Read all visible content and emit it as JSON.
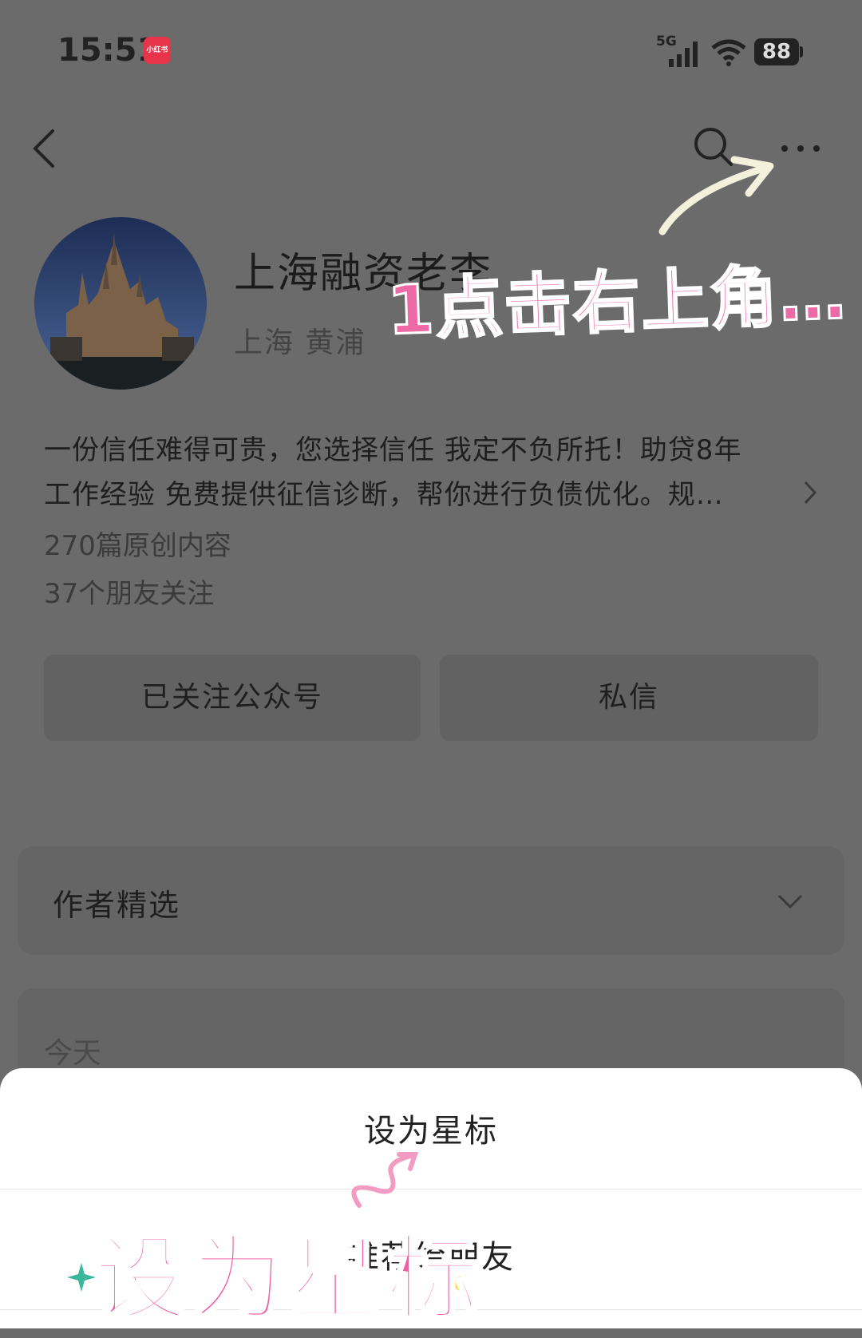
{
  "status_bar": {
    "time": "15:51",
    "app_badge": "小红书",
    "network": "5G",
    "battery": "88"
  },
  "header": {
    "back_icon": "chevron-left-icon",
    "search_icon": "search-icon",
    "more_icon": "more-horizontal-icon"
  },
  "profile": {
    "name": "上海融资老李",
    "location": "上海 黄浦",
    "bio_line1": "一份信任难得可贵，您选择信任 我定不负所托！助贷8年",
    "bio_line2": "工作经验  免费提供征信诊断，帮你进行负债优化。规…",
    "articles": "270篇原创内容",
    "friends_following": "37个朋友关注"
  },
  "actions": {
    "followed_label": "已关注公众号",
    "message_label": "私信"
  },
  "sections": {
    "author_picks": "作者精选",
    "today": "今天"
  },
  "bottom_sheet": {
    "item1": "设为星标",
    "item2": "推荐给朋友"
  },
  "annotations": {
    "step1": "1点击右上角…",
    "step2": "设为星标"
  },
  "colors": {
    "overlay": "#6b6b6b",
    "annotation_pink": "#ee6aa7",
    "badge_red": "#e8344a"
  }
}
